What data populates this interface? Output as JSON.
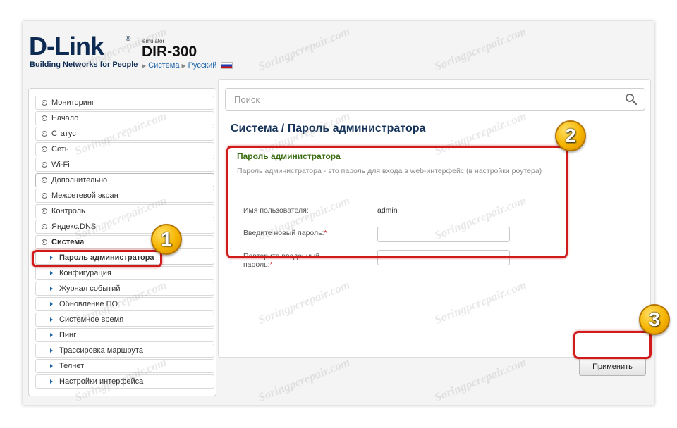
{
  "header": {
    "brand": "D-Link",
    "brand_mark": "®",
    "tagline": "Building Networks for People",
    "emulator_label": "emulator",
    "model": "DIR-300",
    "breadcrumb": [
      "Система",
      "Русский"
    ],
    "flag_icon": "russia-flag-icon"
  },
  "search": {
    "placeholder": "Поиск",
    "icon": "search-icon"
  },
  "sidebar": {
    "items": [
      {
        "label": "Мониторинг",
        "type": "group"
      },
      {
        "label": "Начало",
        "type": "group"
      },
      {
        "label": "Статус",
        "type": "group"
      },
      {
        "label": "Сеть",
        "type": "group"
      },
      {
        "label": "Wi-Fi",
        "type": "group"
      },
      {
        "label": "Дополнительно",
        "type": "group"
      },
      {
        "label": "Межсетевой экран",
        "type": "group"
      },
      {
        "label": "Контроль",
        "type": "group"
      },
      {
        "label": "Яндекс.DNS",
        "type": "group"
      },
      {
        "label": "Система",
        "type": "group-open"
      },
      {
        "label": "Пароль администратора",
        "type": "sub-active"
      },
      {
        "label": "Конфигурация",
        "type": "sub"
      },
      {
        "label": "Журнал событий",
        "type": "sub"
      },
      {
        "label": "Обновление ПО",
        "type": "sub"
      },
      {
        "label": "Системное время",
        "type": "sub"
      },
      {
        "label": "Пинг",
        "type": "sub"
      },
      {
        "label": "Трассировка маршрута",
        "type": "sub"
      },
      {
        "label": "Телнет",
        "type": "sub"
      },
      {
        "label": "Настройки интерфейса",
        "type": "sub"
      }
    ]
  },
  "main": {
    "title_prefix": "Система /",
    "title": "Пароль администратора",
    "section_title": "Пароль администратора",
    "section_desc": "Пароль администратора - это пароль для входа в web-интерфейс (в настройки роутера)",
    "username_label": "Имя пользователя:",
    "username_value": "admin",
    "new_password_label": "Введите новый пароль:",
    "new_password_value": "",
    "repeat_password_label_1": "Повторите введенный",
    "repeat_password_label_2": "пароль:",
    "repeat_password_value": "",
    "required_mark": "*",
    "apply_label": "Применить"
  },
  "annotations": {
    "badge_1": "1",
    "badge_2": "2",
    "badge_3": "3",
    "highlight_color": "#d11a1a"
  },
  "watermark": "Soringpcrepair.com",
  "colors": {
    "brand": "#0d2b52",
    "link": "#1a63a8",
    "section_title": "#3b6d12",
    "page_title": "#17345a"
  }
}
